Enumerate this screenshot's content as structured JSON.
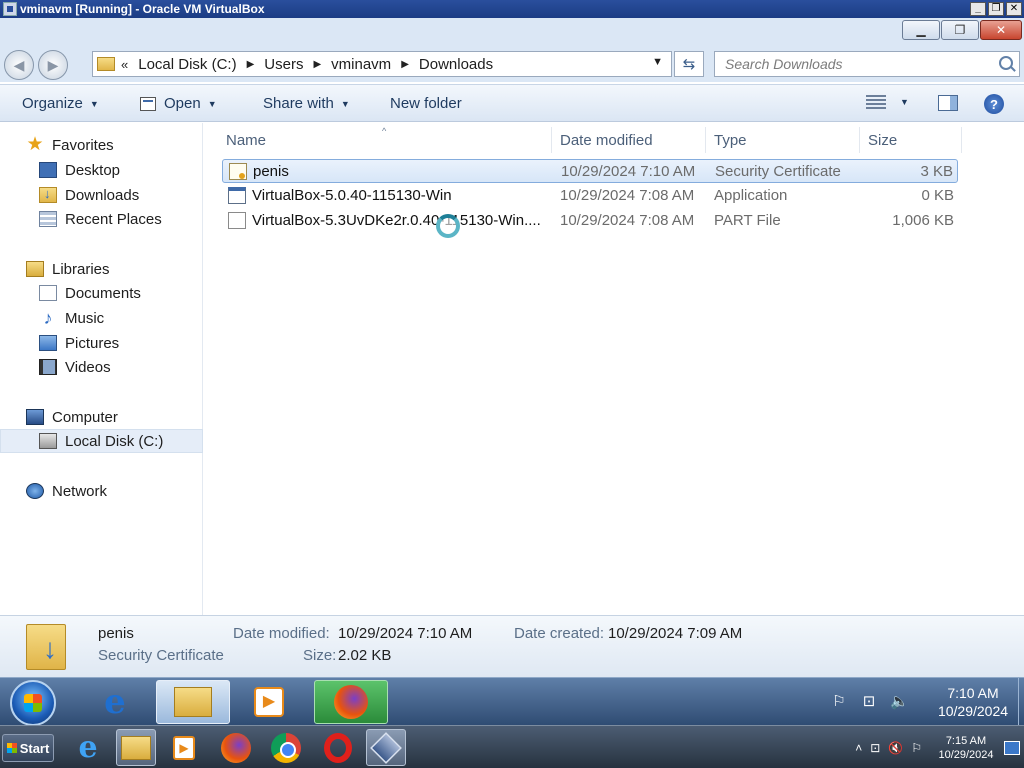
{
  "host_window": {
    "title": "vminavm [Running] - Oracle VM VirtualBox",
    "buttons": [
      "_",
      "❐",
      "✕"
    ]
  },
  "guest_window": {
    "caption_buttons": {
      "minimize": "▁",
      "restore": "❐",
      "close": "✕"
    }
  },
  "address_bar": {
    "overflow": "«",
    "crumbs": [
      "Local Disk (C:)",
      "Users",
      "vminavm",
      "Downloads"
    ],
    "separator": "▶",
    "dropdown": "▼",
    "refresh": "⇆"
  },
  "search": {
    "placeholder": "Search Downloads"
  },
  "command_bar": {
    "organize": "Organize",
    "open": "Open",
    "share_with": "Share with",
    "new_folder": "New folder",
    "dropdown": "▼",
    "help": "?"
  },
  "nav_pane": {
    "favorites": {
      "label": "Favorites",
      "items": [
        "Desktop",
        "Downloads",
        "Recent Places"
      ]
    },
    "libraries": {
      "label": "Libraries",
      "items": [
        "Documents",
        "Music",
        "Pictures",
        "Videos"
      ]
    },
    "computer": {
      "label": "Computer",
      "items": [
        "Local Disk (C:)"
      ]
    },
    "network": {
      "label": "Network"
    },
    "selected": "Local Disk (C:)",
    "icons": {
      "star": "★",
      "music": "♪"
    }
  },
  "file_list": {
    "sort_indicator": "^",
    "columns": [
      "Name",
      "Date modified",
      "Type",
      "Size"
    ],
    "rows": [
      {
        "name": "penis",
        "date": "10/29/2024 7:10 AM",
        "type": "Security Certificate",
        "size": "3 KB",
        "icon": "certificate-icon",
        "selected": true
      },
      {
        "name": "VirtualBox-5.0.40-115130-Win",
        "date": "10/29/2024 7:08 AM",
        "type": "Application",
        "size": "0 KB",
        "icon": "application-icon",
        "selected": false
      },
      {
        "name": "VirtualBox-5.3UvDKe2r.0.40-115130-Win....",
        "date": "10/29/2024 7:08 AM",
        "type": "PART File",
        "size": "1,006 KB",
        "icon": "part-file-icon",
        "selected": false
      }
    ]
  },
  "details_pane": {
    "name": "penis",
    "type": "Security Certificate",
    "date_modified_label": "Date modified:",
    "date_modified": "10/29/2024 7:10 AM",
    "size_label": "Size:",
    "size": "2.02 KB",
    "date_created_label": "Date created:",
    "date_created": "10/29/2024 7:09 AM"
  },
  "guest_taskbar": {
    "apps": [
      "internet-explorer-icon",
      "windows-explorer-icon",
      "media-player-icon",
      "firefox-icon"
    ],
    "active_app": "windows-explorer-icon",
    "clock_time": "7:10 AM",
    "clock_date": "10/29/2024",
    "tray_icons": {
      "flag": "⚐",
      "network": "⊡",
      "volume": "🔈"
    }
  },
  "host_taskbar": {
    "start_label": "Start",
    "apps": [
      "internet-explorer-icon",
      "file-explorer-icon",
      "media-player-icon",
      "firefox-icon",
      "chrome-icon",
      "opera-icon",
      "virtualbox-icon"
    ],
    "active_app": "virtualbox-icon",
    "clock_time": "7:15 AM",
    "clock_date": "10/29/2024",
    "tray_icons": {
      "expand": "˄",
      "network": "⊡",
      "volume_muted": "🔇",
      "flag": "⚐"
    },
    "media_glyph": "▶",
    "ie_glyph": "e"
  },
  "colors": {
    "selection_border": "#84acdd",
    "selection_fill": "#d7e6f8",
    "taskbar": "#2f4c73",
    "host_titlebar": "#1b3c84"
  }
}
